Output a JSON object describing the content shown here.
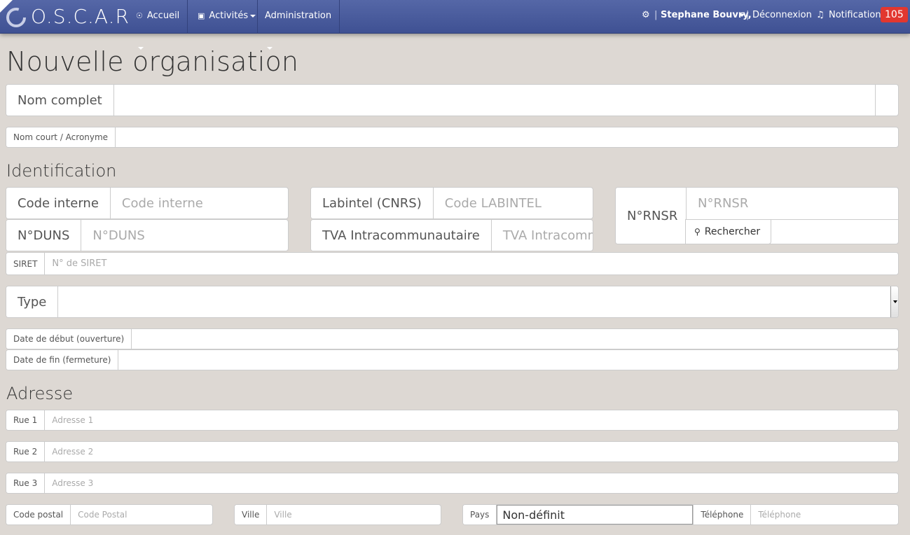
{
  "navbar": {
    "brand": "O.S.C.A.R",
    "menu": {
      "home": "Accueil",
      "activities": "Activités",
      "admin": "Administration"
    },
    "user_separator": "|",
    "user_name": "Stephane Bouvry,",
    "logout_separator": "|",
    "logout": "Déconnexion",
    "notifications": "Notifications",
    "notification_count": "105"
  },
  "page": {
    "title": "Nouvelle organisation"
  },
  "fields": {
    "full_name": {
      "label": "Nom complet",
      "value": ""
    },
    "short_name": {
      "label": "Nom court / Acronyme",
      "value": ""
    }
  },
  "identification": {
    "heading": "Identification",
    "code_interne": {
      "label": "Code interne",
      "placeholder": "Code interne"
    },
    "labintel": {
      "label": "Labintel (CNRS)",
      "placeholder": "Code LABINTEL"
    },
    "rnsr": {
      "label": "N°RNSR",
      "placeholder": "N°RNSR",
      "button": "Rechercher"
    },
    "duns": {
      "label": "N°DUNS",
      "placeholder": "N°DUNS"
    },
    "tva": {
      "label": "TVA Intracommunautaire",
      "placeholder": "TVA Intracomm"
    },
    "siret": {
      "label": "SIRET",
      "placeholder": "N° de SIRET"
    },
    "type": {
      "label": "Type",
      "value": ""
    },
    "date_start": {
      "label": "Date de début (ouverture)",
      "value": ""
    },
    "date_end": {
      "label": "Date de fin (fermeture)",
      "value": ""
    }
  },
  "address": {
    "heading": "Adresse",
    "rue1": {
      "label": "Rue 1",
      "placeholder": "Adresse 1"
    },
    "rue2": {
      "label": "Rue 2",
      "placeholder": "Adresse 2"
    },
    "rue3": {
      "label": "Rue 3",
      "placeholder": "Adresse 3"
    },
    "postal": {
      "label": "Code postal",
      "placeholder": "Code Postal"
    },
    "ville": {
      "label": "Ville",
      "placeholder": "Ville"
    },
    "pays": {
      "label": "Pays",
      "value": "Non-définit"
    },
    "phone": {
      "label": "Téléphone",
      "placeholder": "Téléphone"
    }
  }
}
